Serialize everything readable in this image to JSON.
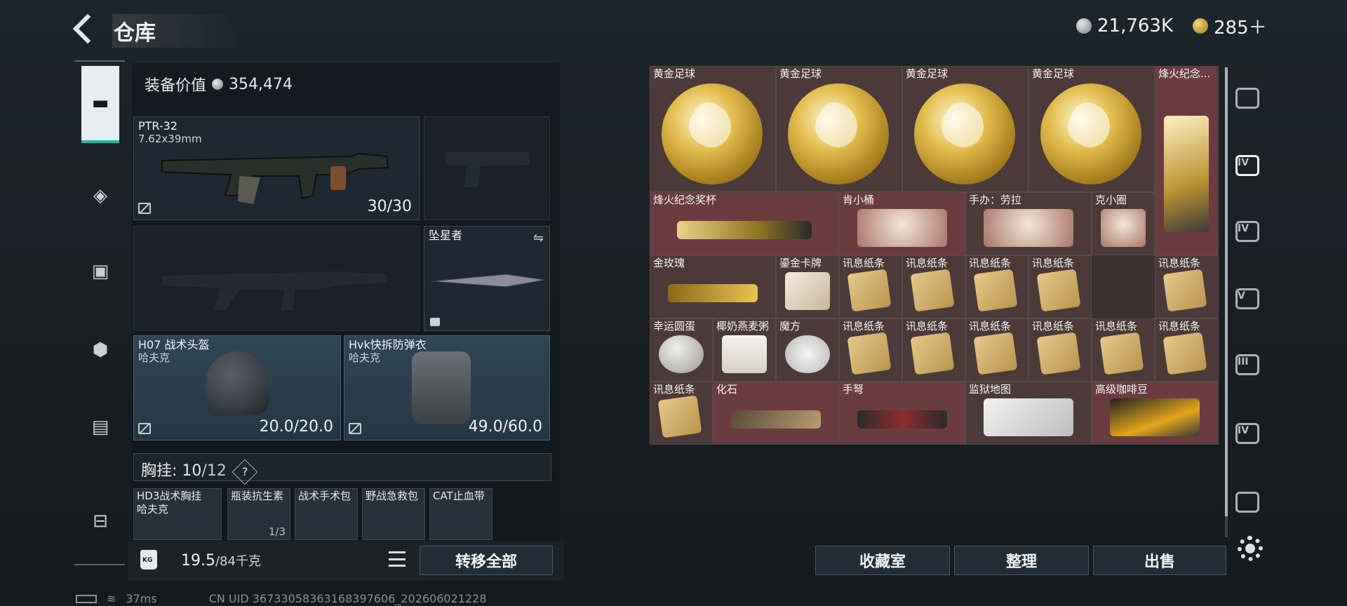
{
  "header": {
    "title": "仓库"
  },
  "currency": {
    "silver": "21,763K",
    "gold": "285＋"
  },
  "equipment": {
    "value_label": "装备价值",
    "value": "354,474",
    "primary": {
      "name": "PTR-32",
      "caliber": "7.62x39mm",
      "ammo": "30/30"
    },
    "melee": {
      "name": "坠星者"
    },
    "helmet": {
      "name": "H07 战术头盔",
      "brand": "哈夫克",
      "durability": "20.0/20.0"
    },
    "armor": {
      "name": "Hvk快拆防弹衣",
      "brand": "哈夫克",
      "durability": "49.0/60.0"
    },
    "chest_rig": {
      "label": "胸挂:",
      "used": "10",
      "capacity": "/12",
      "help": "?"
    },
    "pockets": [
      {
        "label": "HD3战术胸挂",
        "sub": "哈夫克"
      },
      {
        "label": "瓶装抗生素",
        "sub": "1/3"
      },
      {
        "label": "战术手术包",
        "sub": ""
      },
      {
        "label": "野战急救包",
        "sub": ""
      },
      {
        "label": "CAT止血带",
        "sub": ""
      }
    ]
  },
  "bottom_left": {
    "weight": "19.5",
    "weight_cap": "/84千克",
    "transfer_all": "转移全部"
  },
  "stash": {
    "items": [
      {
        "label": "黄金足球",
        "kind": "ball",
        "style": "dark"
      },
      {
        "label": "黄金足球",
        "kind": "ball",
        "style": "dark"
      },
      {
        "label": "黄金足球",
        "kind": "ball",
        "style": "dark"
      },
      {
        "label": "黄金足球",
        "kind": "ball",
        "style": "dark"
      },
      {
        "label": "烽火纪念...",
        "kind": "trophy",
        "style": "red"
      },
      {
        "label": "烽火纪念奖杯",
        "kind": "trophy-lay",
        "style": "red"
      },
      {
        "label": "肯小桶",
        "kind": "figure",
        "style": "red"
      },
      {
        "label": "手办：劳拉",
        "kind": "figure",
        "style": "dark"
      },
      {
        "label": "克小圈",
        "kind": "figure",
        "style": "dark"
      },
      {
        "label": "金玫瑰",
        "kind": "rose",
        "style": "dark"
      },
      {
        "label": "鎏金卡牌",
        "kind": "card",
        "style": "dark"
      },
      {
        "label": "讯息纸条",
        "kind": "paper",
        "style": "dark"
      },
      {
        "label": "讯息纸条",
        "kind": "paper",
        "style": "dark"
      },
      {
        "label": "讯息纸条",
        "kind": "paper",
        "style": "dark"
      },
      {
        "label": "讯息纸条",
        "kind": "paper",
        "style": "dark"
      },
      {
        "label": "讯息纸条",
        "kind": "paper",
        "style": "dark"
      },
      {
        "label": "幸运圆蛋",
        "kind": "egg",
        "style": "dark"
      },
      {
        "label": "椰奶燕麦粥",
        "kind": "can",
        "style": "dark"
      },
      {
        "label": "魔方",
        "kind": "cube",
        "style": "dark"
      },
      {
        "label": "讯息纸条",
        "kind": "paper",
        "style": "dark"
      },
      {
        "label": "讯息纸条",
        "kind": "paper",
        "style": "dark"
      },
      {
        "label": "讯息纸条",
        "kind": "paper",
        "style": "dark"
      },
      {
        "label": "讯息纸条",
        "kind": "paper",
        "style": "dark"
      },
      {
        "label": "讯息纸条",
        "kind": "paper",
        "style": "dark"
      },
      {
        "label": "讯息纸条",
        "kind": "paper",
        "style": "dark"
      },
      {
        "label": "讯息纸条",
        "kind": "paper",
        "style": "dark"
      },
      {
        "label": "化石",
        "kind": "fossil",
        "style": "red"
      },
      {
        "label": "手弩",
        "kind": "crossbow",
        "style": "red"
      },
      {
        "label": "监狱地图",
        "kind": "map",
        "style": "dark"
      },
      {
        "label": "高级咖啡豆",
        "kind": "coffee",
        "style": "red"
      }
    ]
  },
  "buttons": {
    "collection": "收藏室",
    "sort": "整理",
    "sell": "出售"
  },
  "right_nav": [
    "",
    "IV",
    "IV",
    "V",
    "III",
    "IV",
    ""
  ],
  "status": {
    "ping": "37ms",
    "uid": "CN UID 3673305836316839​7606_202606021228"
  }
}
